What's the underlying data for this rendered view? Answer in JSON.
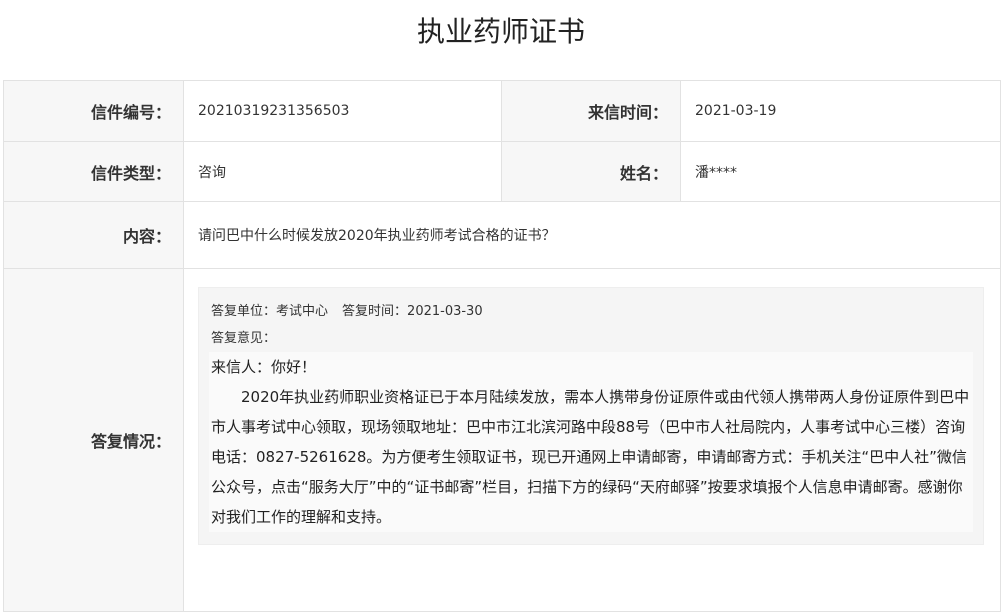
{
  "page": {
    "title": "执业药师证书"
  },
  "letter": {
    "number_label": "信件编号：",
    "number": "20210319231356503",
    "date_label": "来信时间：",
    "date": "2021-03-19",
    "type_label": "信件类型：",
    "type": "咨询",
    "name_label": "姓名：",
    "name": "潘****",
    "content_label": "内容：",
    "content": "请问巴中什么时候发放2020年执业药师考试合格的证书？"
  },
  "reply": {
    "label": "答复情况：",
    "unit_label": "答复单位：",
    "unit": "考试中心",
    "time_label": "答复时间：",
    "time": "2021-03-30",
    "opinion_label": "答复意见：",
    "greeting": "来信人：你好！",
    "body": "2020年执业药师职业资格证已于本月陆续发放，需本人携带身份证原件或由代领人携带两人身份证原件到巴中市人事考试中心领取，现场领取地址：巴中市江北滨河路中段88号（巴中市人社局院内，人事考试中心三楼）咨询电话：0827-5261628。为方便考生领取证书，现已开通网上申请邮寄，申请邮寄方式：手机关注“巴中人社”微信公众号，点击“服务大厅”中的“证书邮寄”栏目，扫描下方的绿码“天府邮驿”按要求填报个人信息申请邮寄。感谢你对我们工作的理解和支持。"
  }
}
